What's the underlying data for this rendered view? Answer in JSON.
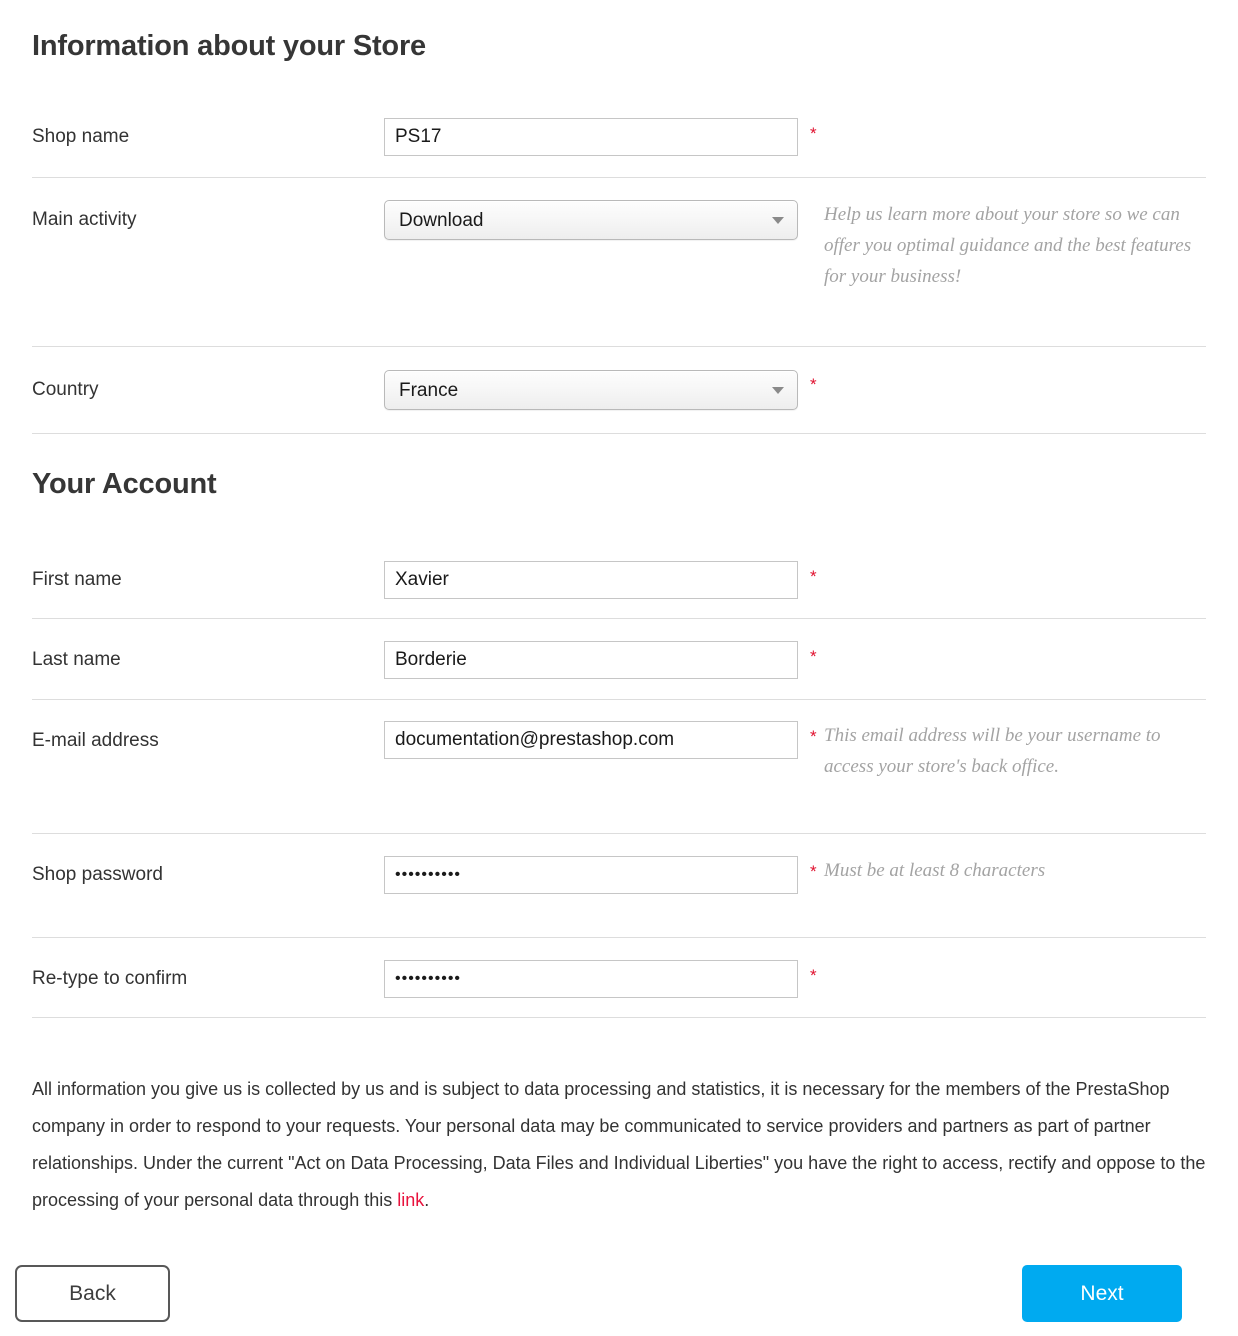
{
  "sections": {
    "store": {
      "title": "Information about your Store"
    },
    "account": {
      "title": "Your Account"
    }
  },
  "fields": {
    "shop_name": {
      "label": "Shop name",
      "value": "PS17",
      "required_mark": "*"
    },
    "main_activity": {
      "label": "Main activity",
      "selected": "Download",
      "hint": "Help us learn more about your store so we can offer you optimal guidance and the best features for your business!",
      "caret_icon": "chevron-down-icon"
    },
    "country": {
      "label": "Country",
      "selected": "France",
      "required_mark": "*",
      "caret_icon": "chevron-down-icon"
    },
    "first_name": {
      "label": "First name",
      "value": "Xavier",
      "required_mark": "*"
    },
    "last_name": {
      "label": "Last name",
      "value": "Borderie",
      "required_mark": "*"
    },
    "email": {
      "label": "E-mail address",
      "value": "documentation@prestashop.com",
      "required_mark": "*",
      "hint": "This email address will be your username to access your store's back office."
    },
    "password": {
      "label": "Shop password",
      "value": "••••••••••",
      "required_mark": "*",
      "hint": "Must be at least 8 characters"
    },
    "password_confirm": {
      "label": "Re-type to confirm",
      "value": "••••••••••",
      "required_mark": "*"
    }
  },
  "legal": {
    "part1": "All information you give us is collected by us and is subject to data processing and statistics, it is necessary for the members of the PrestaShop company in order to respond to your requests. Your personal data may be communicated to service providers and partners as part of partner relationships. Under the current \"Act on Data Processing, Data Files and Individual Liberties\" you have the right to access, rectify and oppose to the processing of your personal data through this ",
    "link_text": "link",
    "part2": "."
  },
  "footer": {
    "back_label": "Back",
    "next_label": "Next"
  },
  "colors": {
    "accent_blue": "#00aaf0",
    "required_red": "#e0102e",
    "link_red": "#e8123c",
    "hint_grey": "#a3a3a3",
    "text_dark": "#333333",
    "divider": "#dddddd"
  }
}
